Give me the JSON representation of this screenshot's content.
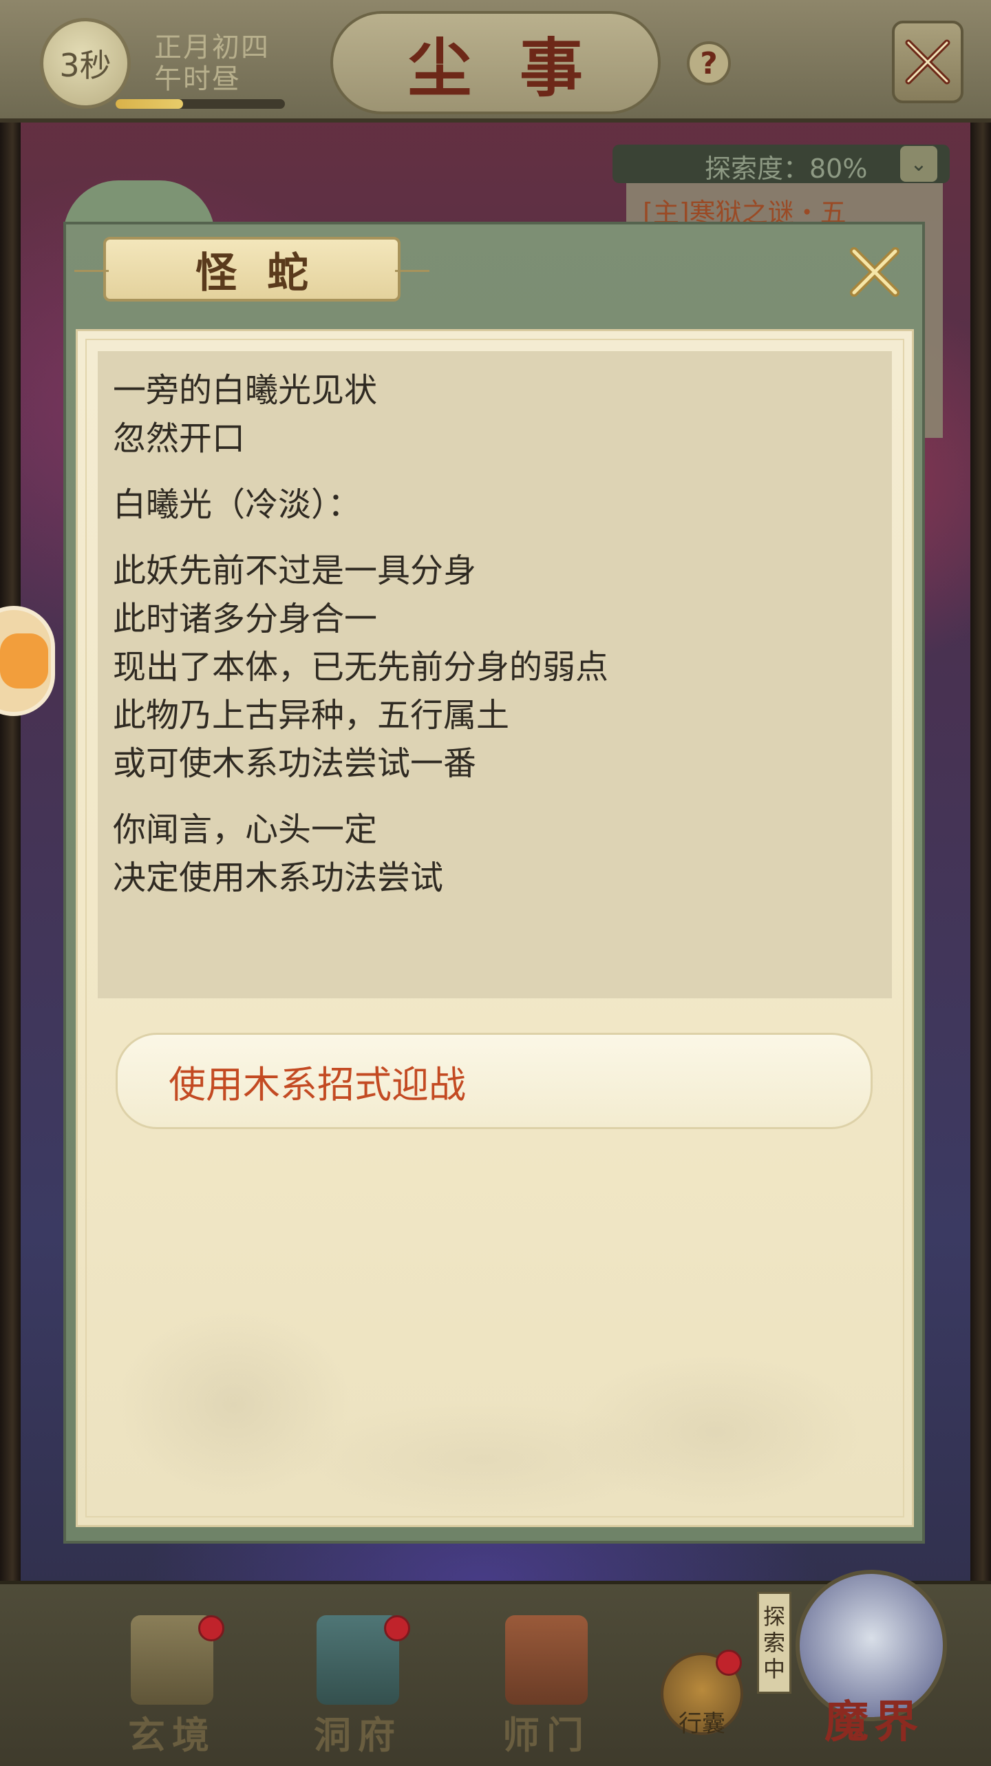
{
  "header": {
    "timer": "3秒",
    "date_line1": "正月初四",
    "date_line2": "午时昼",
    "time_progress": 0.4,
    "title": "尘事",
    "help_symbol": "?"
  },
  "explore": {
    "label": "探索度：80%",
    "quest": "[主]寒狱之谜・五"
  },
  "dialog": {
    "title": "怪蛇",
    "story": [
      [
        "一旁的白曦光见状",
        "忽然开口"
      ],
      [
        "白曦光（冷淡）："
      ],
      [
        "此妖先前不过是一具分身",
        "此时诸多分身合一",
        "现出了本体，已无先前分身的弱点",
        "此物乃上古异种，五行属土",
        "或可使木系功法尝试一番"
      ],
      [
        "你闻言，心头一定",
        "决定使用木系功法尝试"
      ]
    ],
    "choice": "使用木系招式迎战"
  },
  "bottom_nav": {
    "items": [
      {
        "label": "玄境",
        "badge": true
      },
      {
        "label": "洞府",
        "badge": true
      },
      {
        "label": "师门",
        "badge": false
      }
    ],
    "bag_label": "行囊",
    "explore_tag": [
      "探",
      "索",
      "中"
    ],
    "realm_label": "魔界"
  },
  "colors": {
    "title_text": "#6d2818",
    "choice_text": "#c34a22",
    "badge": "#c0232b"
  }
}
